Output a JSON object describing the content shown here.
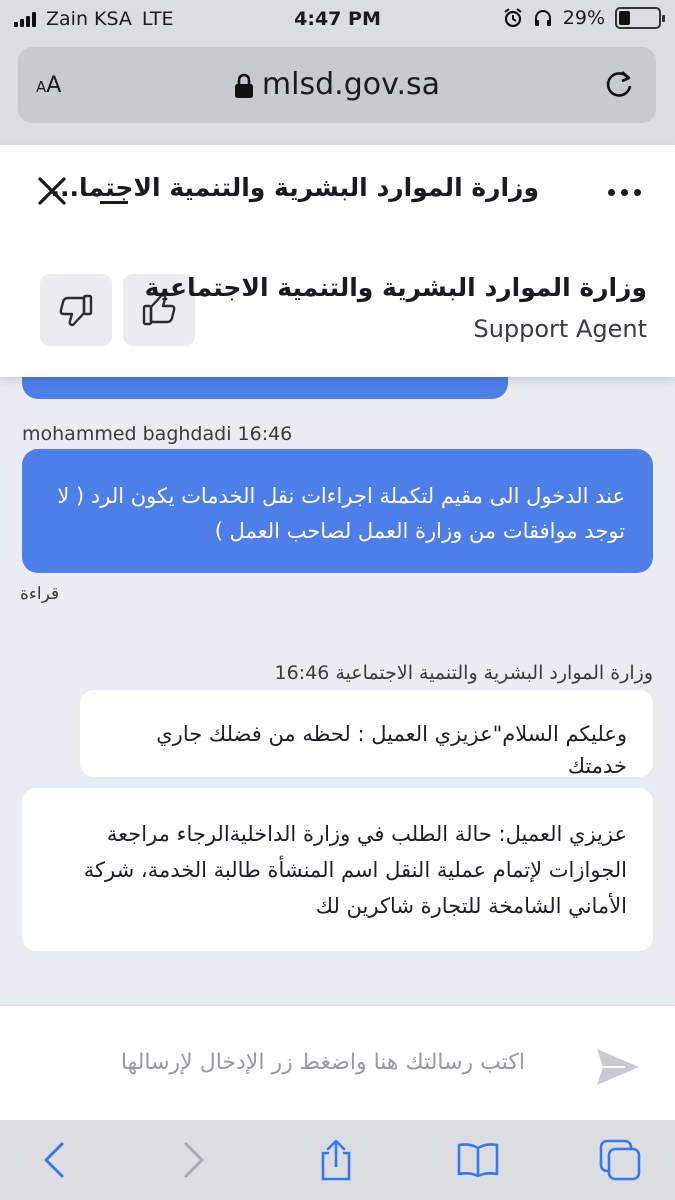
{
  "status_bar": {
    "carrier": "Zain KSA",
    "network": "LTE",
    "time": "4:47 PM",
    "battery": "29%",
    "battery_level": 0.29
  },
  "browser": {
    "aa_small": "A",
    "aa_large": "A",
    "url": "mlsd.gov.sa"
  },
  "chat_header": {
    "title": "وزارة الموارد البشرية والتنمية الاجتما...",
    "agent_name": "وزارة الموارد البشرية والتنمية الاجتماعية",
    "agent_role": "Support Agent"
  },
  "messages": {
    "user_sender": "mohammed baghdadi 16:46",
    "user_text": "عند الدخول الى مقيم لتكملة اجراءات نقل الخدمات يكون الرد ( لا توجد موافقات من وزارة العمل لصاحب العمل )",
    "read_status": "قراءة",
    "agent_sender": "وزارة الموارد البشرية والتنمية الاجتماعية 16:46",
    "agent_text_1": "وعليكم السلام\"عزيزي العميل : لحظه من فضلك جاري خدمتك",
    "agent_text_2": "عزيزي العميل: حالة الطلب في وزارة الداخليةالرجاء مراجعة الجوازات لإتمام عملية النقل اسم المنشأة طالبة الخدمة، شركة الأماني الشامخة للتجارة شاكرين لك"
  },
  "input": {
    "placeholder": "اكتب رسالتك هنا واضغط زر الإدخال لإرسالها"
  },
  "colors": {
    "user_bubble": "#4e7ee8",
    "agent_bubble": "#ffffff",
    "chat_background": "#e9ecf1",
    "toolbar_icons": "#3478f6"
  },
  "icons": {
    "close": "close-icon",
    "minimize": "minimize-icon",
    "more": "more-icon",
    "thumb_up": "thumbs-up-icon",
    "thumb_down": "thumbs-down-icon",
    "send": "send-icon",
    "back": "back-icon",
    "forward": "forward-icon",
    "share": "share-icon",
    "bookmarks": "bookmarks-icon",
    "tabs": "tabs-icon"
  }
}
